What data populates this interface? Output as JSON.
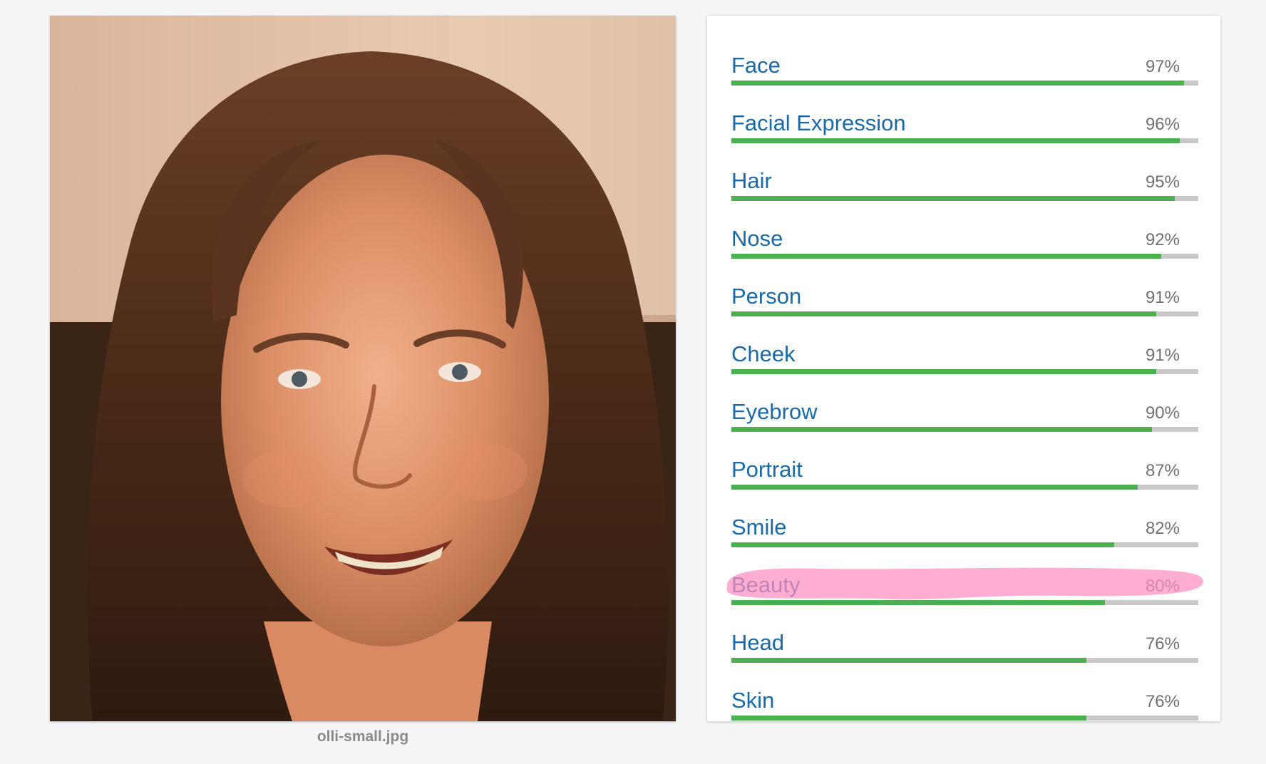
{
  "image": {
    "filename": "olli-small.jpg"
  },
  "labels": [
    {
      "name": "Face",
      "score_text": "97%",
      "score": 0.97
    },
    {
      "name": "Facial Expression",
      "score_text": "96%",
      "score": 0.96
    },
    {
      "name": "Hair",
      "score_text": "95%",
      "score": 0.95
    },
    {
      "name": "Nose",
      "score_text": "92%",
      "score": 0.92
    },
    {
      "name": "Person",
      "score_text": "91%",
      "score": 0.91
    },
    {
      "name": "Cheek",
      "score_text": "91%",
      "score": 0.91
    },
    {
      "name": "Eyebrow",
      "score_text": "90%",
      "score": 0.9
    },
    {
      "name": "Portrait",
      "score_text": "87%",
      "score": 0.87
    },
    {
      "name": "Smile",
      "score_text": "82%",
      "score": 0.82
    },
    {
      "name": "Beauty",
      "score_text": "80%",
      "score": 0.8
    },
    {
      "name": "Head",
      "score_text": "76%",
      "score": 0.76
    },
    {
      "name": "Skin",
      "score_text": "76%",
      "score": 0.76
    }
  ],
  "colors": {
    "label_text": "#1a6aa8",
    "bar_fill": "#4caf50",
    "bar_track": "#c8c8c8",
    "highlight": "#ff8fc0"
  },
  "annotation": {
    "highlighted_label": "Beauty"
  }
}
